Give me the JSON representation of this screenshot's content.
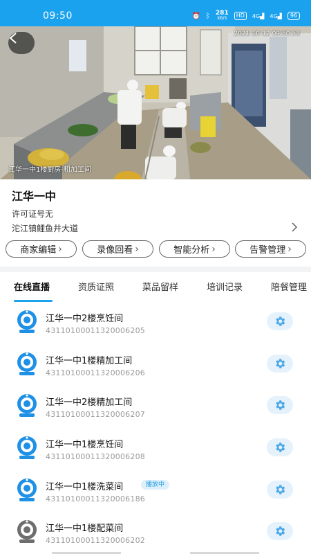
{
  "status_bar": {
    "time": "09:50",
    "net_speed": "281",
    "net_unit": "KB/S",
    "hd": "HD",
    "sig1": "4G",
    "sig2": "4G",
    "battery": "96"
  },
  "video": {
    "timestamp": "2021-10-12 09:50:53",
    "caption": "江华一中1楼厨房-粗加工间"
  },
  "merchant": {
    "name": "江华一中",
    "license": "许可证号无",
    "address": "沱江镇鲤鱼井大道"
  },
  "actions": [
    {
      "label": "商家编辑"
    },
    {
      "label": "录像回看"
    },
    {
      "label": "智能分析"
    },
    {
      "label": "告警管理"
    }
  ],
  "tabs": [
    {
      "label": "在线直播"
    },
    {
      "label": "资质证照"
    },
    {
      "label": "菜品留样"
    },
    {
      "label": "培训记录"
    },
    {
      "label": "陪餐管理"
    }
  ],
  "cameras": [
    {
      "name": "江华一中2楼烹饪间",
      "id": "43110100011320006205",
      "status": "online",
      "icon": "camera-icon"
    },
    {
      "name": "江华一中1楼精加工间",
      "id": "43110100011320006206",
      "status": "online",
      "icon": "camera-icon"
    },
    {
      "name": "江华一中2楼精加工间",
      "id": "43110100011320006207",
      "status": "online",
      "icon": "camera-icon"
    },
    {
      "name": "江华一中1楼烹饪间",
      "id": "43110100011320006208",
      "status": "online",
      "icon": "camera-icon"
    },
    {
      "name": "江华一中1楼洗菜间",
      "id": "43110100011320006186",
      "status": "online",
      "icon": "camera-icon",
      "badge": "播放中"
    },
    {
      "name": "江华一中1楼配菜间",
      "id": "43110100011320006202",
      "status": "offline",
      "icon": "camera-icon"
    }
  ],
  "colors": {
    "accent": "#1ba2ef",
    "camera_online": "#1e90e6",
    "camera_offline": "#6e6e6e",
    "gear": "#4aa8e8"
  }
}
